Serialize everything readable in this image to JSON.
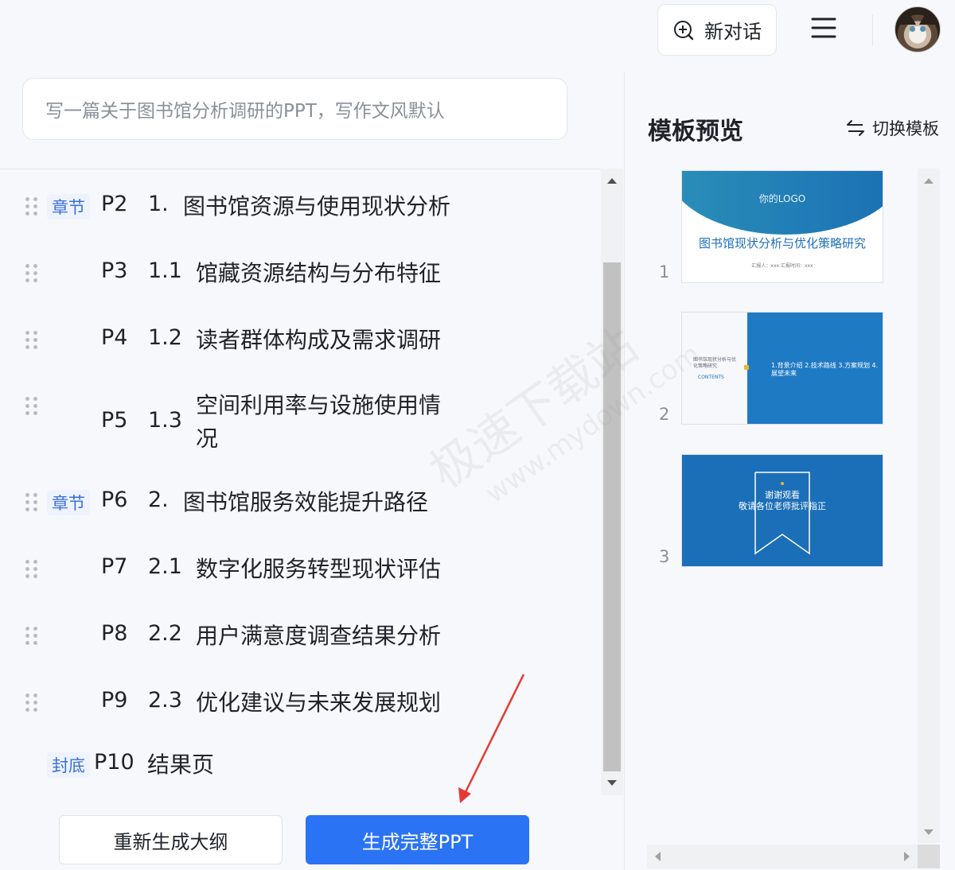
{
  "header": {
    "new_chat_label": "新对话"
  },
  "prompt": {
    "placeholder": "写一篇关于图书馆分析调研的PPT，写作文风默认"
  },
  "outline": {
    "rows": [
      {
        "tag": "章节",
        "page": "P2",
        "num": "1.",
        "title": "图书馆资源与使用现状分析"
      },
      {
        "tag": "",
        "page": "P3",
        "num": "1.1",
        "title": "馆藏资源结构与分布特征"
      },
      {
        "tag": "",
        "page": "P4",
        "num": "1.2",
        "title": "读者群体构成及需求调研"
      },
      {
        "tag": "",
        "page": "P5",
        "num": "1.3",
        "title": "空间利用率与设施使用情况"
      },
      {
        "tag": "章节",
        "page": "P6",
        "num": "2.",
        "title": "图书馆服务效能提升路径"
      },
      {
        "tag": "",
        "page": "P7",
        "num": "2.1",
        "title": "数字化服务转型现状评估"
      },
      {
        "tag": "",
        "page": "P8",
        "num": "2.2",
        "title": "用户满意度调查结果分析"
      },
      {
        "tag": "",
        "page": "P9",
        "num": "2.3",
        "title": "优化建议与未来发展规划"
      },
      {
        "tag": "封底",
        "page": "P10",
        "num": "",
        "title": "结果页"
      }
    ]
  },
  "actions": {
    "regenerate_label": "重新生成大纲",
    "generate_label": "生成完整PPT"
  },
  "preview": {
    "title": "模板预览",
    "switch_label": "切换模板",
    "slides": [
      {
        "index": "1",
        "logo": "你的LOGO",
        "title": "图书馆现状分析与优化策略研究",
        "meta": "汇报人：xxx 汇报时间：xxx"
      },
      {
        "index": "2",
        "left_text": "图书馆现状分析与优化策略研究",
        "left_label": "CONTENTS",
        "right_text": "1.背景介绍 2.技术路线 3.方案规划 4.展望未来"
      },
      {
        "index": "3",
        "line1": "谢谢观看",
        "line2": "敬请各位老师批评指正"
      }
    ]
  },
  "watermark": {
    "line1": "极速下载站",
    "line2": "www.mydown.com"
  },
  "colors": {
    "primary": "#2a73f5",
    "tag_bg": "#eef3ff",
    "tag_text": "#3a6fd8",
    "arrow": "#e53935"
  }
}
